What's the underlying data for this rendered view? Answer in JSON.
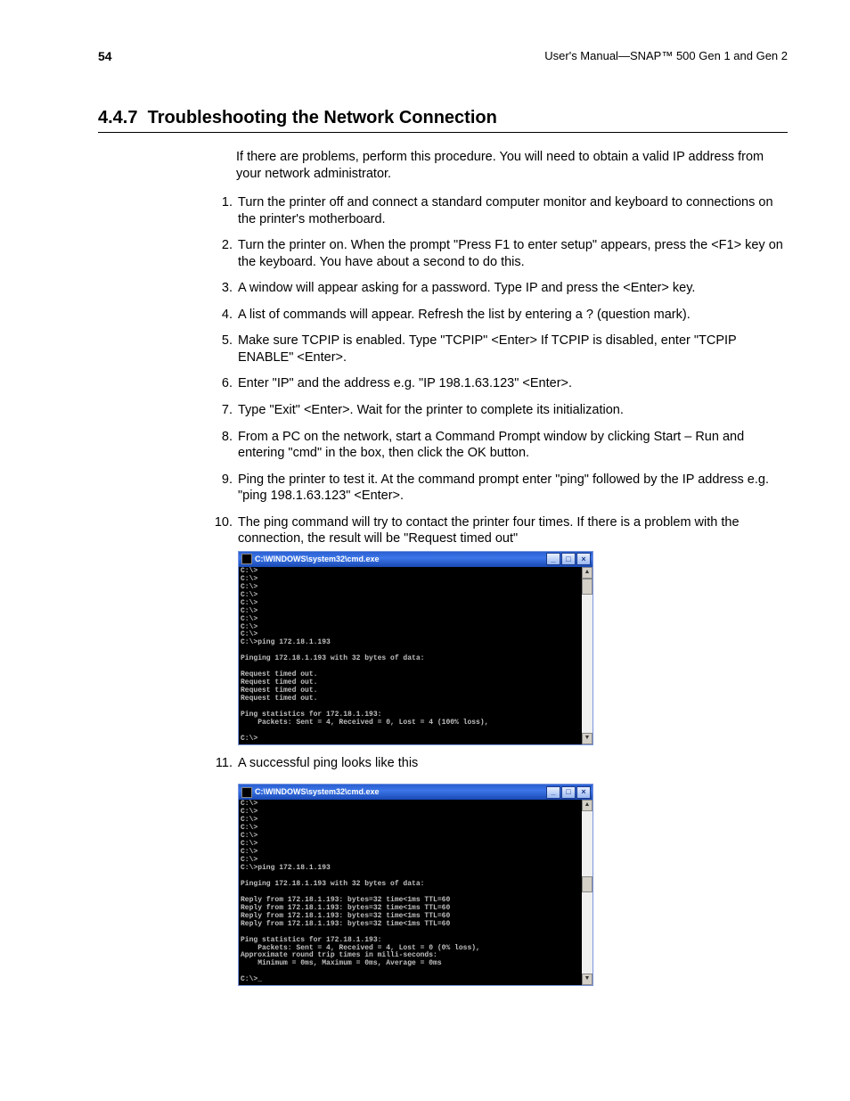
{
  "header": {
    "page_number": "54",
    "doc_title": "User's Manual—SNAP™ 500 Gen 1 and Gen 2"
  },
  "section": {
    "number": "4.4.7",
    "title": "Troubleshooting the Network Connection"
  },
  "intro": "If there are problems, perform this procedure. You will need to obtain a valid IP address from your network administrator.",
  "steps": [
    "Turn the printer off and connect a standard computer monitor and keyboard to connections on the printer's motherboard.",
    "Turn the printer on. When the prompt \"Press F1 to enter setup\" appears, press the <F1> key on the keyboard. You have about a second to do this.",
    "A window will appear asking for a password. Type IP and press the <Enter> key.",
    "A list of commands will appear. Refresh the list by entering a ? (question mark).",
    "Make sure TCPIP is enabled. Type \"TCPIP\" <Enter> If TCPIP is disabled, enter \"TCPIP ENABLE\" <Enter>.",
    "Enter \"IP\" and the address e.g. \"IP 198.1.63.123\" <Enter>.",
    "Type \"Exit\" <Enter>. Wait for the printer to complete its initialization.",
    "From a PC on the network, start a Command Prompt window by clicking Start – Run and entering \"cmd\" in the box, then click the OK button.",
    "Ping the printer to test it. At the command prompt enter \"ping\" followed by the IP address e.g. \"ping 198.1.63.123\" <Enter>.",
    "The ping command will try to contact the printer four times. If there is a problem with the connection, the result will be \"Request timed out\"",
    "A successful ping looks like this"
  ],
  "cmd1": {
    "title": "C:\\WINDOWS\\system32\\cmd.exe",
    "text": "C:\\>\nC:\\>\nC:\\>\nC:\\>\nC:\\>\nC:\\>\nC:\\>\nC:\\>\nC:\\>\nC:\\>ping 172.18.1.193\n\nPinging 172.18.1.193 with 32 bytes of data:\n\nRequest timed out.\nRequest timed out.\nRequest timed out.\nRequest timed out.\n\nPing statistics for 172.18.1.193:\n    Packets: Sent = 4, Received = 0, Lost = 4 (100% loss),\n\nC:\\>"
  },
  "cmd2": {
    "title": "C:\\WINDOWS\\system32\\cmd.exe",
    "text": "C:\\>\nC:\\>\nC:\\>\nC:\\>\nC:\\>\nC:\\>\nC:\\>\nC:\\>\nC:\\>ping 172.18.1.193\n\nPinging 172.18.1.193 with 32 bytes of data:\n\nReply from 172.18.1.193: bytes=32 time<1ms TTL=60\nReply from 172.18.1.193: bytes=32 time<1ms TTL=60\nReply from 172.18.1.193: bytes=32 time<1ms TTL=60\nReply from 172.18.1.193: bytes=32 time<1ms TTL=60\n\nPing statistics for 172.18.1.193:\n    Packets: Sent = 4, Received = 4, Lost = 0 (0% loss),\nApproximate round trip times in milli-seconds:\n    Minimum = 0ms, Maximum = 0ms, Average = 0ms\n\nC:\\>_"
  },
  "win_btns": {
    "min": "_",
    "max": "□",
    "close": "×"
  }
}
